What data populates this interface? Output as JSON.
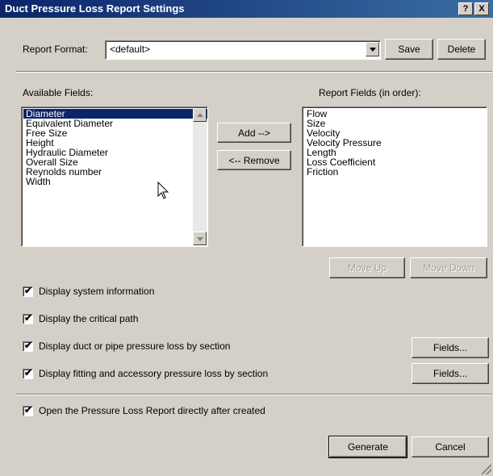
{
  "window": {
    "title": "Duct Pressure Loss Report Settings",
    "help_label": "?",
    "close_label": "X"
  },
  "report_format": {
    "label": "Report Format:",
    "value": "<default>",
    "save_label": "Save",
    "delete_label": "Delete"
  },
  "available": {
    "label": "Available Fields:",
    "items": [
      "Diameter",
      "Equivalent Diameter",
      "Free Size",
      "Height",
      "Hydraulic Diameter",
      "Overall Size",
      "Reynolds number",
      "Width"
    ],
    "selected_index": 0
  },
  "report_fields": {
    "label": "Report Fields (in order):",
    "items": [
      "Flow",
      "Size",
      "Velocity",
      "Velocity Pressure",
      "Length",
      "Loss Coefficient",
      "Friction"
    ]
  },
  "buttons": {
    "add": "Add -->",
    "remove": "<-- Remove",
    "move_up": "Move Up",
    "move_down": "Move Down",
    "fields1": "Fields...",
    "fields2": "Fields...",
    "generate": "Generate",
    "cancel": "Cancel"
  },
  "options": [
    {
      "label": "Display system information",
      "checked": true
    },
    {
      "label": "Display the critical path",
      "checked": true
    },
    {
      "label": "Display duct or pipe pressure loss by section",
      "checked": true
    },
    {
      "label": "Display fitting and accessory pressure loss by section",
      "checked": true
    },
    {
      "label": "Open the Pressure Loss Report directly after created",
      "checked": true
    }
  ],
  "check_mark": "✔"
}
